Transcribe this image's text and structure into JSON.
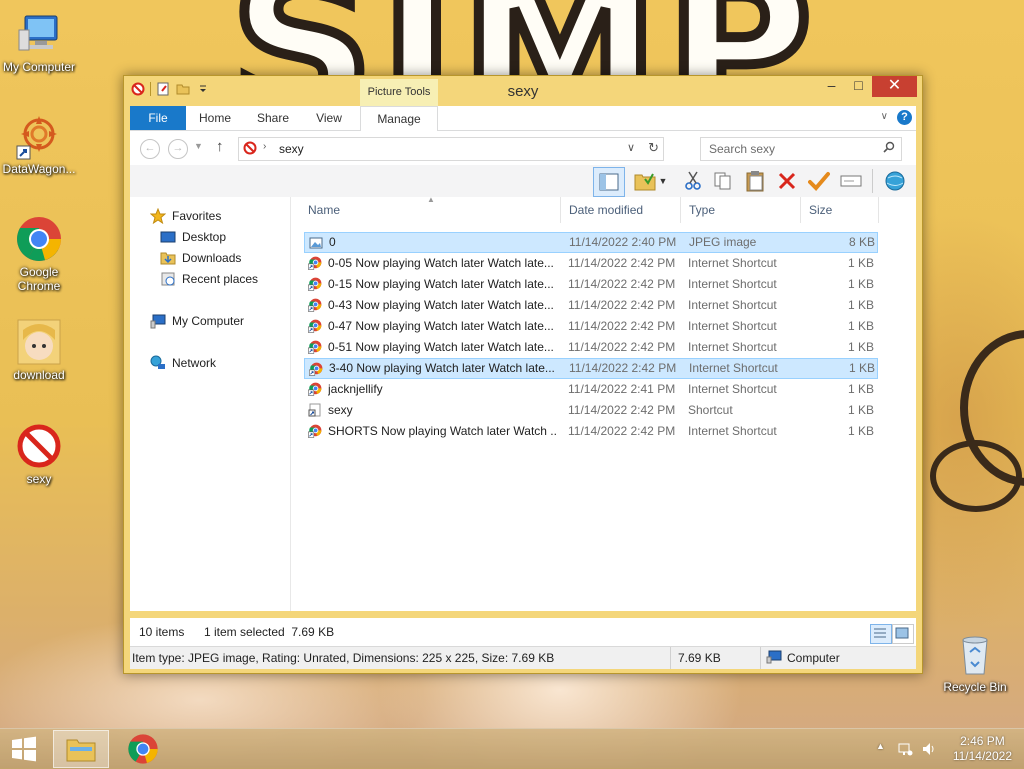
{
  "desktop": {
    "icons": [
      {
        "label": "My Computer"
      },
      {
        "label": "DataWagon..."
      },
      {
        "label": "Google Chrome"
      },
      {
        "label": "download"
      },
      {
        "label": "sexy"
      },
      {
        "label": "Recycle Bin"
      }
    ],
    "wallpaper_text": "SIMP"
  },
  "window": {
    "title": "sexy",
    "contextual_tab_group": "Picture Tools",
    "ribbon_tabs": [
      "File",
      "Home",
      "Share",
      "View",
      "Manage"
    ],
    "address": {
      "path": "sexy"
    },
    "search": {
      "placeholder": "Search sexy"
    },
    "nav": {
      "favorites": "Favorites",
      "desktop": "Desktop",
      "downloads": "Downloads",
      "recent": "Recent places",
      "computer": "My Computer",
      "network": "Network"
    },
    "columns": {
      "name": "Name",
      "date": "Date modified",
      "type": "Type",
      "size": "Size"
    },
    "files": [
      {
        "name": "0",
        "date": "11/14/2022 2:40 PM",
        "type": "JPEG image",
        "size": "8 KB",
        "icon": "image-icon"
      },
      {
        "name": "0-05 Now playing Watch later Watch late...",
        "date": "11/14/2022 2:42 PM",
        "type": "Internet Shortcut",
        "size": "1 KB",
        "icon": "chrome-shortcut-icon"
      },
      {
        "name": "0-15 Now playing Watch later Watch late...",
        "date": "11/14/2022 2:42 PM",
        "type": "Internet Shortcut",
        "size": "1 KB",
        "icon": "chrome-shortcut-icon"
      },
      {
        "name": "0-43 Now playing Watch later Watch late...",
        "date": "11/14/2022 2:42 PM",
        "type": "Internet Shortcut",
        "size": "1 KB",
        "icon": "chrome-shortcut-icon"
      },
      {
        "name": "0-47 Now playing Watch later Watch late...",
        "date": "11/14/2022 2:42 PM",
        "type": "Internet Shortcut",
        "size": "1 KB",
        "icon": "chrome-shortcut-icon"
      },
      {
        "name": "0-51 Now playing Watch later Watch late...",
        "date": "11/14/2022 2:42 PM",
        "type": "Internet Shortcut",
        "size": "1 KB",
        "icon": "chrome-shortcut-icon"
      },
      {
        "name": "3-40 Now playing Watch later Watch late...",
        "date": "11/14/2022 2:42 PM",
        "type": "Internet Shortcut",
        "size": "1 KB",
        "icon": "chrome-shortcut-icon"
      },
      {
        "name": "jacknjellify",
        "date": "11/14/2022 2:41 PM",
        "type": "Internet Shortcut",
        "size": "1 KB",
        "icon": "chrome-shortcut-icon"
      },
      {
        "name": "sexy",
        "date": "11/14/2022 2:42 PM",
        "type": "Shortcut",
        "size": "1 KB",
        "icon": "shortcut-icon"
      },
      {
        "name": "SHORTS Now playing Watch later Watch ...",
        "date": "11/14/2022 2:42 PM",
        "type": "Internet Shortcut",
        "size": "1 KB",
        "icon": "chrome-shortcut-icon"
      }
    ],
    "status": {
      "item_count": "10 items",
      "selection": "1 item selected  7.69 KB",
      "details": "Item type: JPEG image, Rating: Unrated, Dimensions: 225 x 225, Size: 7.69 KB",
      "size": "7.69 KB",
      "location": "Computer"
    }
  },
  "taskbar": {
    "time": "2:46 PM",
    "date": "11/14/2022"
  },
  "colors": {
    "accent": "#1979ca",
    "close": "#c84031",
    "selection": "#cde8ff",
    "window_frame": "#f4d67a"
  }
}
